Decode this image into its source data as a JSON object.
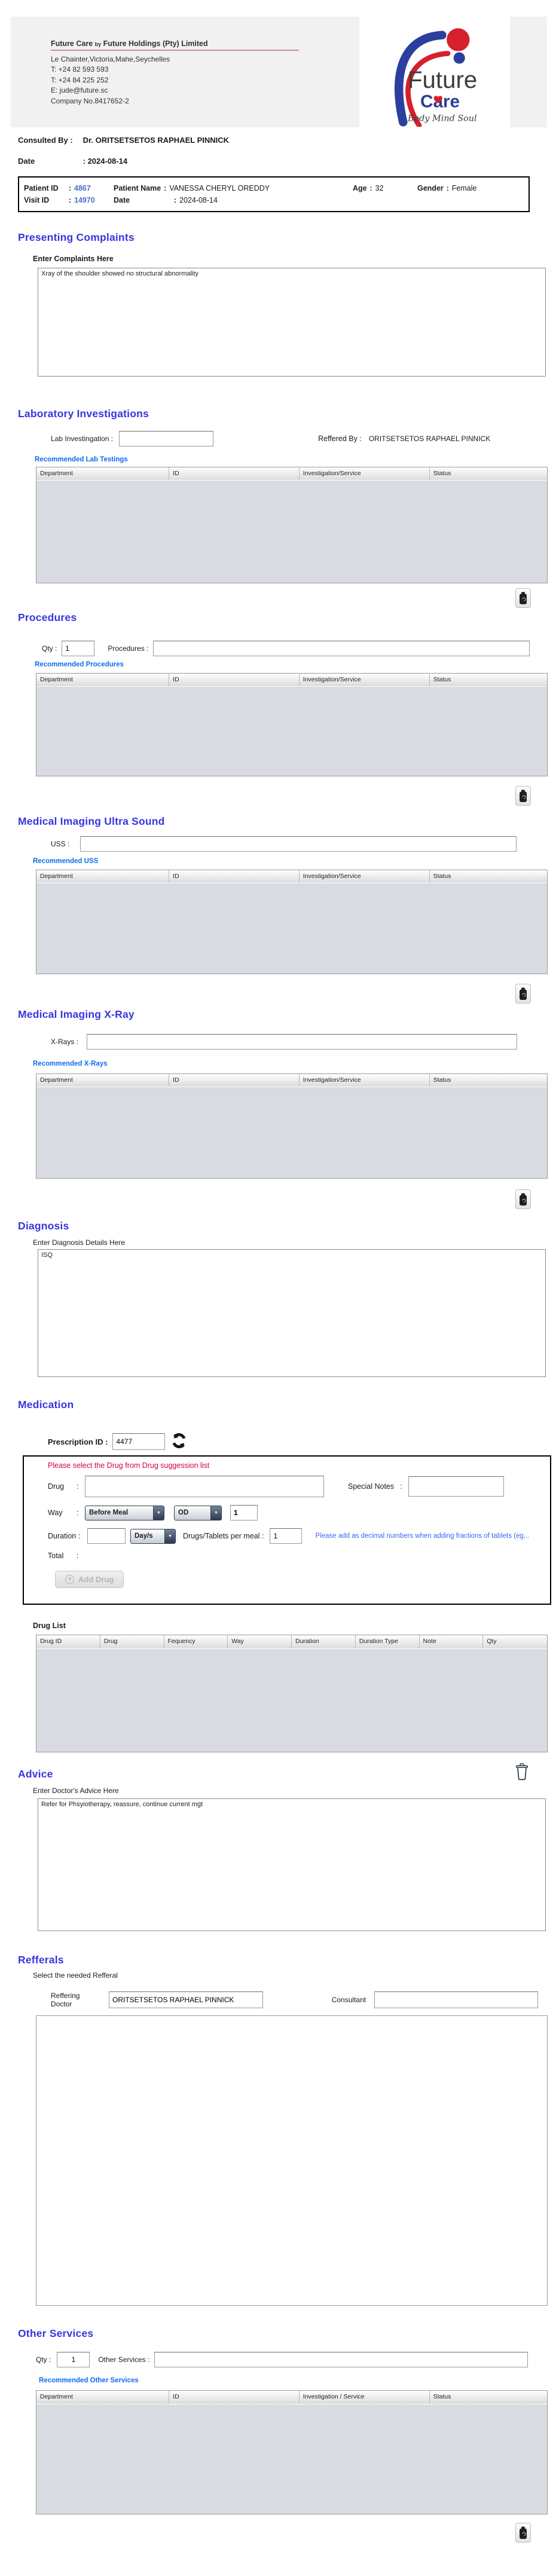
{
  "colors": {
    "section_heading": "#3636e0",
    "recommended_link": "#0d6bf0",
    "id_value_blue": "#4a6fc9",
    "warning_red": "#d40045",
    "hint_blue": "#3e63f0",
    "table_body_gray": "#d8dbe2",
    "header_band_gray": "#f2f1f2",
    "logo_blue": "#2b3f9e",
    "logo_red": "#d6202c"
  },
  "icons": {
    "dropdown_arrow": "▼",
    "plus": "+"
  },
  "header": {
    "company_name_main": "Future Care",
    "company_name_by": "by",
    "company_name_rest": "Future Holdings (Pty) Limited",
    "address": "Le Chainter,Victoria,Mahe,Seychelles",
    "phone1": "T: +24  82 593 593",
    "phone2": "T: +24  84 225 252",
    "email": "E: jude@future.sc",
    "company_no": "Company No.8417652-2",
    "logo": {
      "line1": "Future",
      "line2": "Care",
      "tagline": "Body Mind Soul"
    }
  },
  "consult": {
    "consulted_by_label": "Consulted By :",
    "consulted_by_value": "Dr.  ORITSETSETOS RAPHAEL PINNICK",
    "date_label": "Date",
    "date_value": ": 2024-08-14"
  },
  "patient_bar": {
    "patient_id_label": "Patient ID",
    "colon": ":",
    "patient_id_value": "4867",
    "patient_name_label": "Patient Name",
    "patient_name_value": "VANESSA CHERYL OREDDY",
    "age_label": "Age",
    "age_value": "32",
    "gender_label": "Gender",
    "gender_value": "Female",
    "visit_id_label": "Visit ID",
    "visit_id_value": "14970",
    "date_label": "Date",
    "date_value": "2024-08-14"
  },
  "presenting_complaints": {
    "title": "Presenting Complaints",
    "label": "Enter Complaints Here",
    "value": "Xray of the shoulder showed no structural abnormality"
  },
  "laboratory": {
    "title": "Laboratory  Investigations",
    "lab_label": "Lab Investingation :",
    "reffered_label": "Reffered By :",
    "reffered_value": "ORITSETSETOS RAPHAEL PINNICK",
    "link": "Recommended Lab Testings",
    "table": {
      "headers": [
        "Department",
        "ID",
        "Investigation/Service",
        "Status"
      ],
      "rows": []
    }
  },
  "procedures": {
    "title": "Procedures",
    "qty_label": "Qty :",
    "qty_value": "1",
    "label": "Procedures :",
    "link": "Recommended Procedures",
    "table": {
      "headers": [
        "Department",
        "ID",
        "Investigation/Service",
        "Status"
      ],
      "rows": []
    }
  },
  "ultrasound": {
    "title": "Medical Imaging Ultra Sound",
    "label": "USS :",
    "link": "Recommended USS",
    "table": {
      "headers": [
        "Department",
        "ID",
        "Investigation/Service",
        "Status"
      ],
      "rows": []
    }
  },
  "xray": {
    "title": "Medical Imaging X-Ray",
    "label": "X-Rays :",
    "link": "Recommended X-Rays",
    "table": {
      "headers": [
        "Department",
        "ID",
        "Investigation/Service",
        "Status"
      ],
      "rows": []
    }
  },
  "diagnosis": {
    "title": "Diagnosis",
    "label": "Enter Diagnosis Details Here",
    "value": "ISQ"
  },
  "medication": {
    "title": "Medication",
    "prescription_label": "Prescription ID :",
    "prescription_value": "4477",
    "warning": "Please select the Drug from Drug suggession list",
    "drug_label": "Drug",
    "drug_colon": ":",
    "special_notes_label": "Special Notes   :",
    "way_label": "Way",
    "way_colon": ":",
    "way_select_value": "Before Meal",
    "frequency_select_value": "OD",
    "way_qty_value": "1",
    "duration_label": "Duration :",
    "duration_unit_value": "Day/s",
    "per_meal_label": "Drugs/Tablets per meal :",
    "per_meal_value": "1",
    "hint": "Please add as decimal numbers when adding fractions of tablets (eg...",
    "total_label": "Total",
    "total_colon": ":",
    "add_drug_label": "Add Drug",
    "drug_list_label": "Drug List",
    "drug_table": {
      "headers": [
        "Drug ID",
        "Drug",
        "Fequency",
        "Way",
        "Duration",
        "Duration Type",
        "Note",
        "Qty"
      ],
      "rows": []
    }
  },
  "advice": {
    "title": "Advice",
    "label": "Enter Doctor's Advice Here",
    "value": "Refer for Phsyiotherapy, reassure, continue current mgt"
  },
  "refferals": {
    "title": "Refferals",
    "label": "Select the needed Refferal",
    "reffering_doctor_label": "Reffering Doctor",
    "reffering_doctor_value": "ORITSETSETOS RAPHAEL PINNICK",
    "consultant_label": "Consultant",
    "consultant_value": ""
  },
  "other_services": {
    "title": "Other Services",
    "qty_label": "Qty :",
    "qty_value": "1",
    "label": "Other Services :",
    "link": "Recommended Other Services",
    "table": {
      "headers": [
        "Department",
        "ID",
        "Investigation / Service",
        "Status"
      ],
      "rows": []
    }
  }
}
